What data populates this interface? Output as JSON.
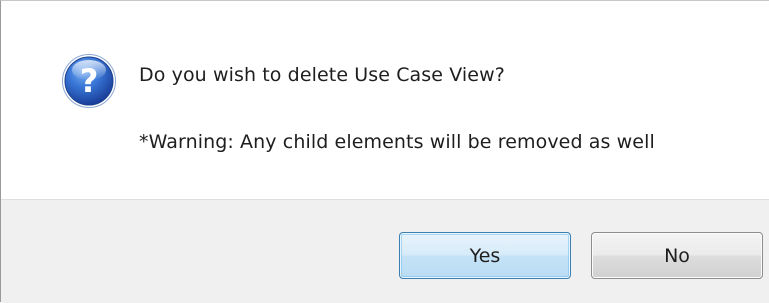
{
  "dialog": {
    "icon": "question-icon",
    "message": "Do you wish to delete Use Case View?",
    "warning": "*Warning: Any child elements will be removed as well"
  },
  "buttons": {
    "yes_label": "Yes",
    "no_label": "No"
  },
  "colors": {
    "icon_blue": "#2a5fc8",
    "default_button_border": "#3c7fb1",
    "footer_background": "#f0f0f0"
  }
}
